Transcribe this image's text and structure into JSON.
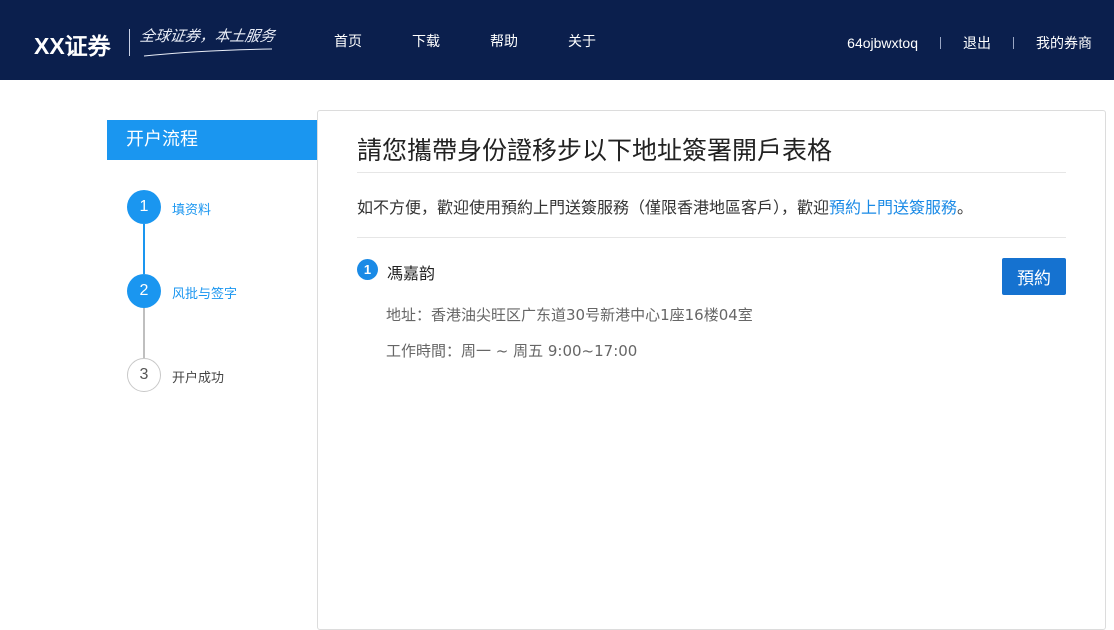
{
  "header": {
    "logo": "XX证券",
    "slogan": "全球证券，本土服务",
    "nav": [
      "首页",
      "下载",
      "帮助",
      "关于"
    ],
    "username": "64ojbwxtoq",
    "logout": "退出",
    "my_broker": "我的券商",
    "background_color": "#0b1f4d"
  },
  "sidebar": {
    "title": "开户流程",
    "steps": [
      {
        "number": "1",
        "label": "填资料",
        "state": "active"
      },
      {
        "number": "2",
        "label": "风批与签字",
        "state": "active"
      },
      {
        "number": "3",
        "label": "开户成功",
        "state": "inactive"
      }
    ],
    "accent_color": "#1a96f0"
  },
  "main": {
    "title": "請您攜帶身份證移步以下地址簽署開戶表格",
    "notice_prefix": "如不方便，歡迎使用預約上門送簽服務（僅限香港地區客戶），歡迎",
    "notice_link": "預約上門送簽服務",
    "notice_suffix": "。",
    "entries": [
      {
        "number": "1",
        "name": "馮嘉韵",
        "address": "地址：香港油尖旺区广东道30号新港中心1座16楼04室",
        "hours": "工作時間：周一 ~ 周五 9:00~17:00",
        "button": "預約"
      }
    ],
    "button_color": "#1572d0"
  }
}
